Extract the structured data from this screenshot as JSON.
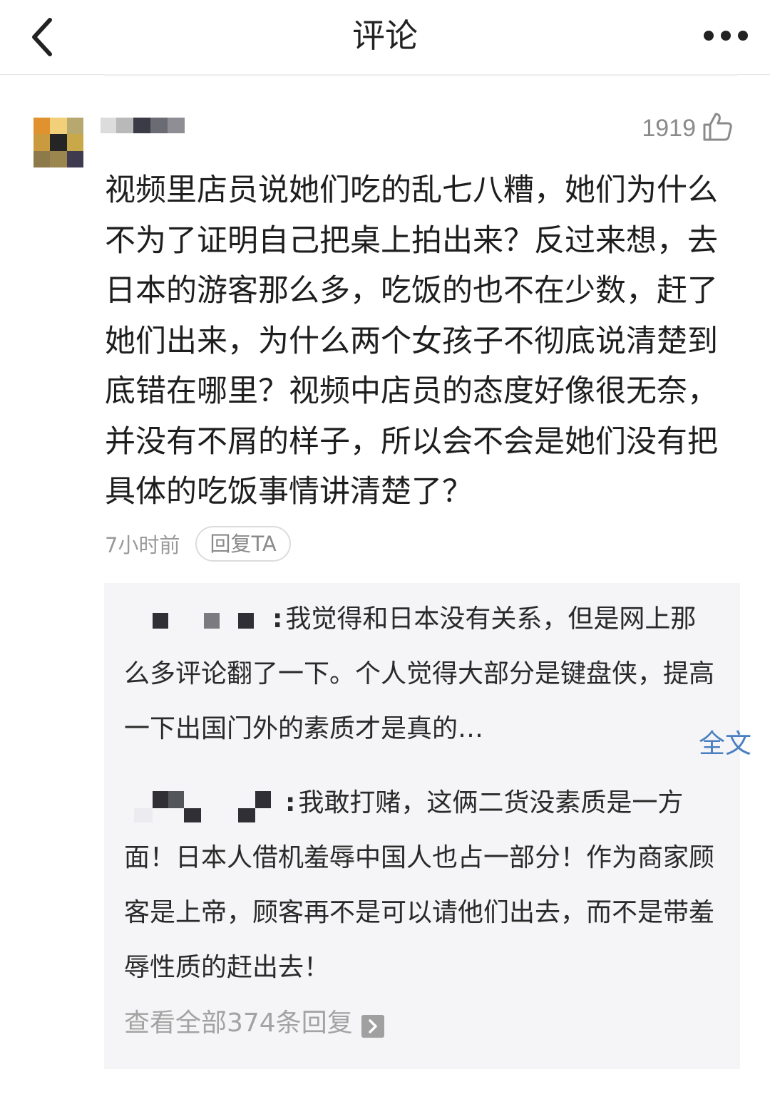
{
  "header": {
    "title": "评论"
  },
  "comment": {
    "likes": "1919",
    "text": "视频里店员说她们吃的乱七八糟，她们为什么不为了证明自己把桌上拍出来？反过来想，去日本的游客那么多，吃饭的也不在少数，赶了她们出来，为什么两个女孩子不彻底说清楚到底错在哪里？视频中店员的态度好像很无奈，并没有不屑的样子，所以会不会是她们没有把具体的吃饭事情讲清楚了？",
    "time": "7小时前",
    "reply_button": "回复TA"
  },
  "replies": [
    {
      "text": "我觉得和日本没有关系，但是网上那么多评论翻了一下。个人觉得大部分是键盘侠，提高一下出国门外的素质才是真的…",
      "more": "全文"
    },
    {
      "text": "我敢打赌，这俩二货没素质是一方面！日本人借机羞辱中国人也占一部分！作为商家顾客是上帝，顾客再不是可以请他们出去，而不是带羞辱性质的赶出去！"
    }
  ],
  "view_all": "查看全部374条回复",
  "icons": {
    "back": "chevron-left-icon",
    "more": "more-dots-icon",
    "like": "thumbs-up-icon",
    "view_all_arrow": "chevron-right-icon"
  },
  "colors": {
    "link": "#4a7fc1",
    "muted": "#9a9a9a",
    "reply_bg": "#f5f5f7"
  }
}
